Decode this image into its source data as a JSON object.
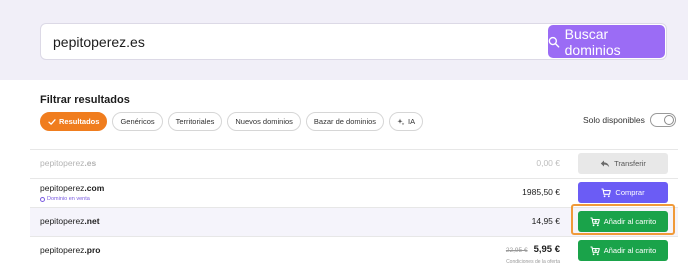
{
  "search": {
    "value": "pepitoperez.es",
    "button_label": "Buscar dominios"
  },
  "filters": {
    "title": "Filtrar resultados",
    "chips": [
      {
        "label": "Resultados",
        "active": true
      },
      {
        "label": "Genéricos"
      },
      {
        "label": "Territoriales"
      },
      {
        "label": "Nuevos dominios"
      },
      {
        "label": "Bazar de dominios"
      },
      {
        "label": "IA"
      }
    ],
    "only_available_label": "Solo disponibles"
  },
  "results": [
    {
      "name": "pepitoperez",
      "tld": ".es",
      "price": "0,00 €",
      "action": "Transferir",
      "style": "grey"
    },
    {
      "name": "pepitoperez",
      "tld": ".com",
      "note": "Dominio en venta",
      "price": "1985,50 €",
      "action": "Comprar",
      "style": "purple"
    },
    {
      "name": "pepitoperez",
      "tld": ".net",
      "price": "14,95 €",
      "action": "Añadir al carrito",
      "style": "green"
    },
    {
      "name": "pepitoperez",
      "tld": ".pro",
      "old_price": "22,95 €",
      "price": "5,95 €",
      "price_note": "Condiciones de la oferta",
      "action": "Añadir al carrito",
      "style": "green"
    }
  ],
  "colors": {
    "accent_purple": "#9b6cf5",
    "buy_purple": "#6b5cf5",
    "green": "#1aa34a",
    "orange": "#f07d1e"
  }
}
